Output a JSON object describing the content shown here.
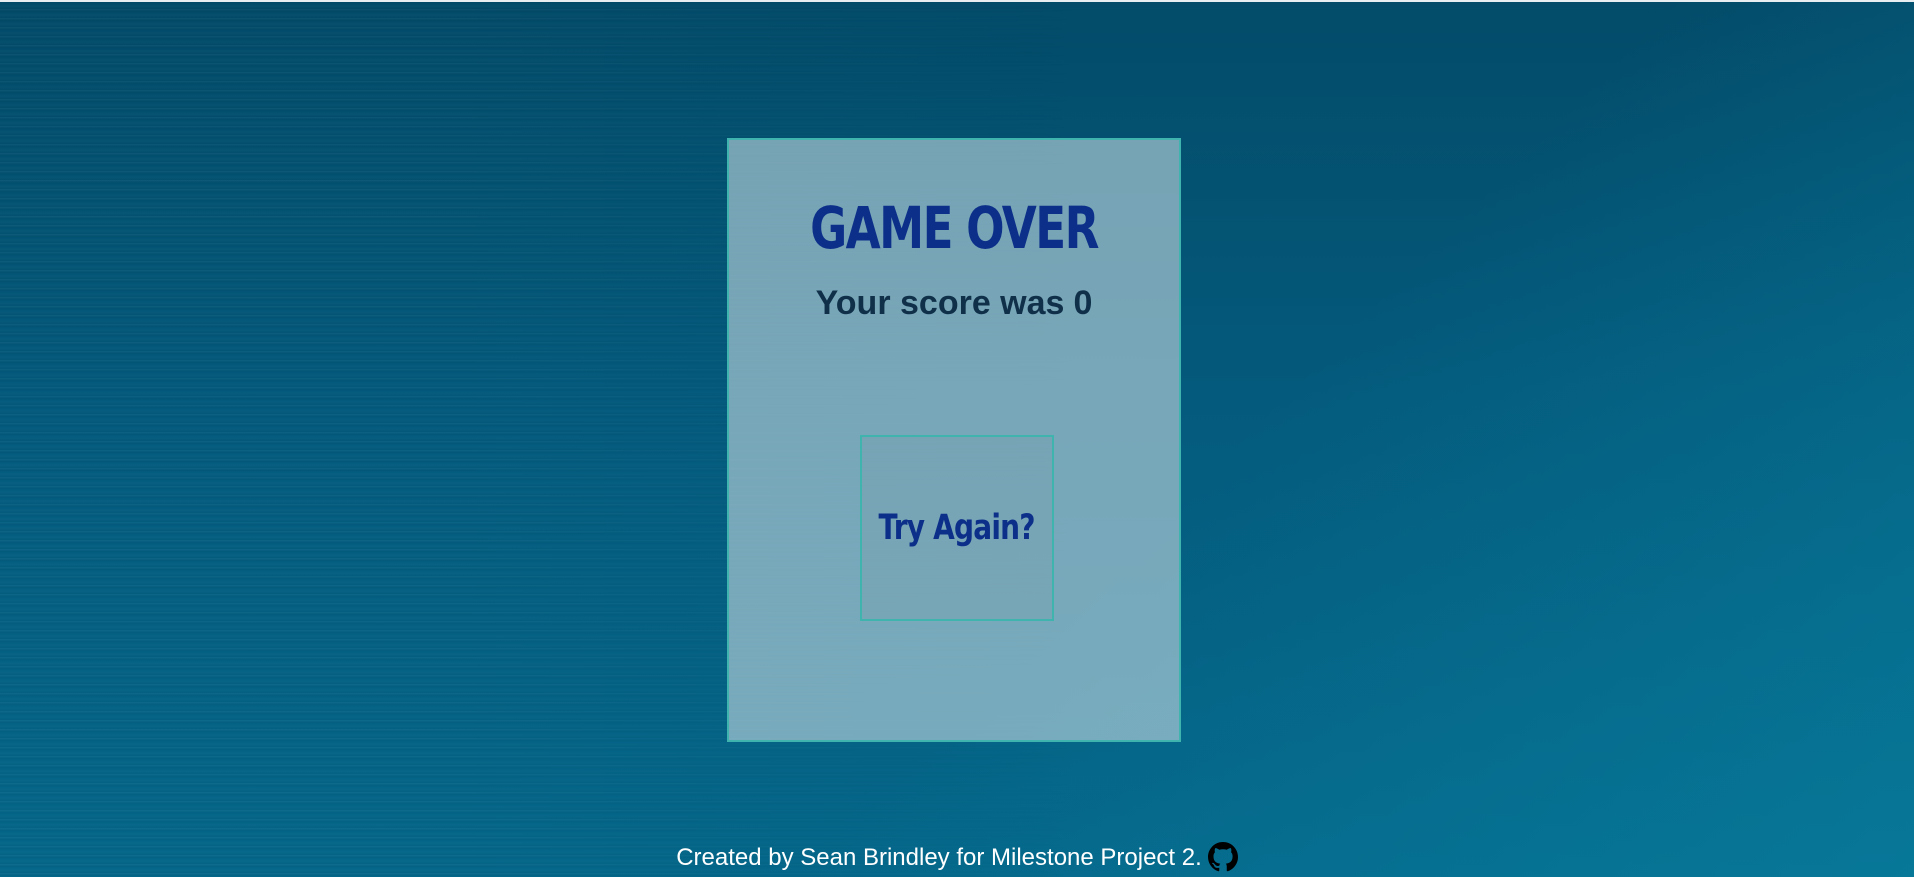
{
  "game_over": {
    "title": "GAME OVER",
    "score_label": "Your score was",
    "score_value": "0",
    "try_again_label": "Try Again?"
  },
  "footer": {
    "credit_text": "Created by Sean Brindley for Milestone Project 2.",
    "link_icon": "github-icon"
  },
  "colors": {
    "background": "#045a7c",
    "card_border": "#3fb3ad",
    "title": "#0c2f8a",
    "score_text": "#10304a",
    "footer_text": "#ffffff"
  }
}
